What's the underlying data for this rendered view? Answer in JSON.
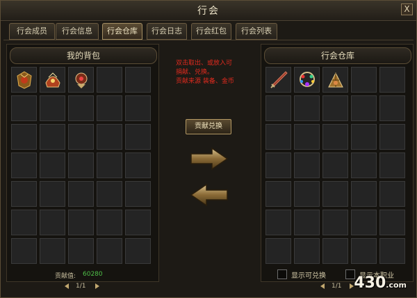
{
  "window": {
    "title": "行会",
    "close_label": "X"
  },
  "tabs": [
    {
      "label": "行会成员",
      "active": false
    },
    {
      "label": "行会信息",
      "active": false
    },
    {
      "label": "行会仓库",
      "active": true
    },
    {
      "label": "行会日志",
      "active": false
    },
    {
      "label": "行会红包",
      "active": false
    },
    {
      "label": "行会列表",
      "active": false
    }
  ],
  "left_panel": {
    "title": "我的背包",
    "items": [
      "armor-set-icon",
      "helmet-icon",
      "amulet-icon"
    ],
    "contribution_label": "贡献值:",
    "contribution_value": "60280",
    "page": "1/1"
  },
  "center": {
    "notice_lines": [
      "双击取出、或放入可",
      "捐献、兑换。",
      "贡献来源 装备、金币"
    ],
    "contribute_button": "贡献兑换"
  },
  "right_panel": {
    "title": "行会仓库",
    "items": [
      "sword-icon",
      "jewel-necklace-icon",
      "fan-icon"
    ],
    "checkbox_redeemable": "显示可兑换",
    "checkbox_class": "显示本职业",
    "page": "1/1"
  },
  "watermark": {
    "text": "430",
    "suffix": ".com"
  }
}
